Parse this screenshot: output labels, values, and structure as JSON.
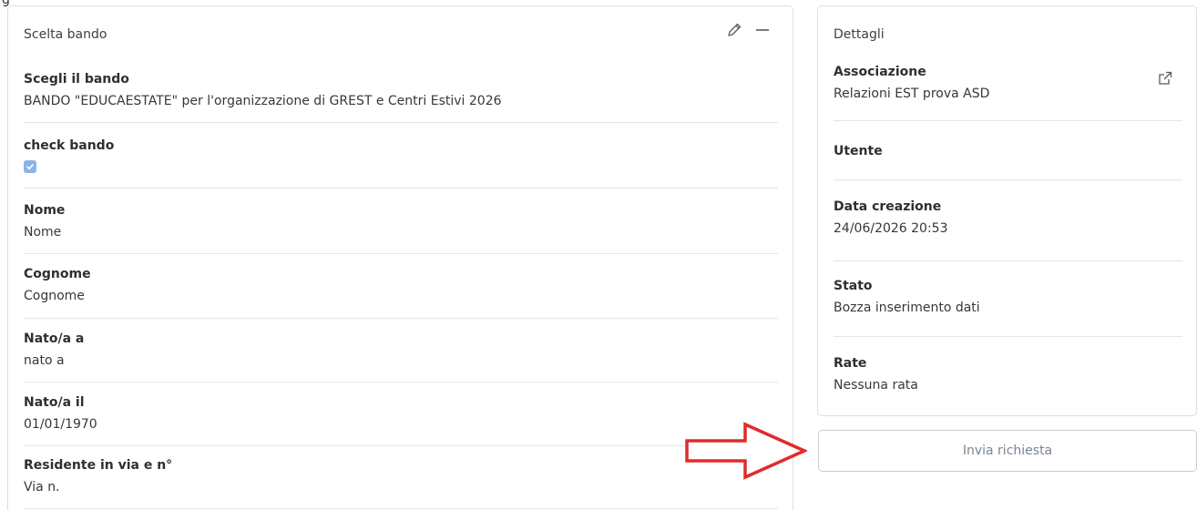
{
  "stray": {
    "glyph": "g"
  },
  "left_panel": {
    "title": "Scelta bando",
    "fields": [
      {
        "label": "Scegli il bando",
        "value": "BANDO \"EDUCAESTATE\" per l'organizzazione di GREST e Centri Estivi 2026"
      },
      {
        "label": "check bando",
        "checked": true
      },
      {
        "label": "Nome",
        "value": "Nome"
      },
      {
        "label": "Cognome",
        "value": "Cognome"
      },
      {
        "label": "Nato/a a",
        "value": "nato a"
      },
      {
        "label": "Nato/a il",
        "value": "01/01/1970"
      },
      {
        "label": "Residente in via e n°",
        "value": "Via n."
      }
    ],
    "icons": [
      "pencil-icon",
      "minus-icon"
    ]
  },
  "right_panel": {
    "title": "Dettagli",
    "fields": [
      {
        "label": "Associazione",
        "value": "Relazioni EST prova ASD",
        "icon": "external-link-icon"
      },
      {
        "label": "Utente",
        "value": ""
      },
      {
        "label": "Data creazione",
        "value": "24/06/2026 20:53"
      },
      {
        "label": "Stato",
        "value": "Bozza inserimento dati"
      },
      {
        "label": "Rate",
        "value": "Nessuna rata"
      }
    ]
  },
  "submit_button": {
    "label": "Invia richiesta"
  },
  "colors": {
    "annotation_arrow": "#e02b2b",
    "checkbox": "#8cb4e6",
    "border": "#dcdfe3"
  }
}
